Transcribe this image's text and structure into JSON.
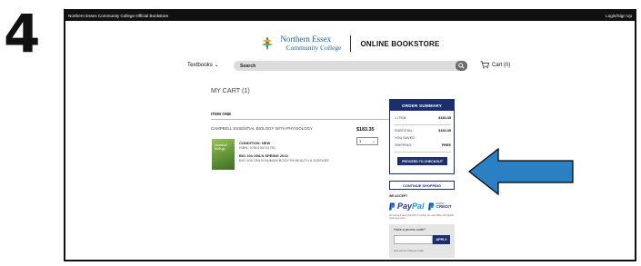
{
  "step_number": "4",
  "topbar": {
    "site_name": "Northern Essex Community College Official Bookstore",
    "login": "Login/Sign Up"
  },
  "header": {
    "logo_line1": "Northern Essex",
    "logo_line2": "Community College",
    "store_title": "ONLINE BOOKSTORE"
  },
  "nav": {
    "textbooks_label": "Textbooks",
    "search_placeholder": "Search",
    "cart_label": "Cart (0)"
  },
  "cart": {
    "title": "MY CART (1)",
    "item_heading": "ITEM ONE",
    "product_name": "CAMPBELL ESSENTIAL BIOLOGY WITH PHYSIOLOGY",
    "price": "$183.35",
    "quantity": "1",
    "cover_title_1": "essential",
    "cover_title_2": "biology",
    "condition": "CONDITION: NEW",
    "isbn": "ISBN: 9780134711751",
    "course_code": "BIO 104 ONLN  SPRING 2022",
    "course_name": "BIO 104 ONLN HUMAN BODY IN HEALTH & DISEASE"
  },
  "summary": {
    "heading": "ORDER SUMMARY",
    "items_label": "1 ITEM",
    "items_value": "$183.35",
    "subtotal_label": "SUBTOTAL:",
    "subtotal_value": "$183.35",
    "saved_label": "YOU SAVED:",
    "saved_value": "",
    "shipping_label": "SHIPPING:",
    "shipping_value": "FREE",
    "checkout_label": "PROCEED TO CHECKOUT"
  },
  "continue_label": "CONTINUE SHOPPING",
  "payment": {
    "we_accept": "WE ACCEPT",
    "paypal_pay": "Pay",
    "paypal_pal": "Pal",
    "paypal_credit_1": "PayPal",
    "paypal_credit_2": "CREDIT",
    "note": "No Interest if paid in full within 6 months. On orders $99+ with PayPal credit. See terms."
  },
  "promo": {
    "label": "Have a promo code?",
    "input_value": "",
    "apply_label": "APPLY",
    "note": "One promo code per order."
  },
  "colors": {
    "navy": "#1b2f6e",
    "arrow_blue": "#2b7fc3",
    "topbar": "#111111",
    "search_bg": "#dcdcdc"
  }
}
